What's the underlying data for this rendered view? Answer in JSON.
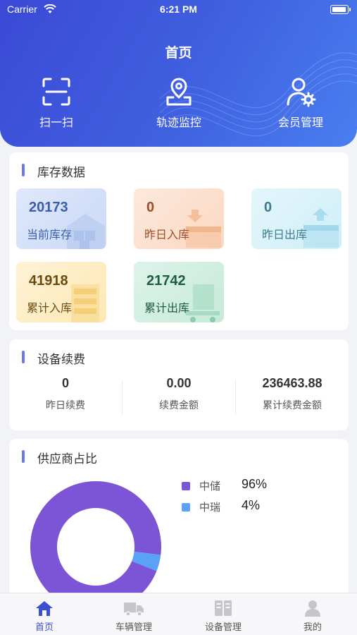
{
  "status_bar": {
    "carrier": "Carrier",
    "time": "6:21 PM"
  },
  "page_title": "首页",
  "quick_actions": [
    {
      "label": "扫一扫",
      "icon": "scan-icon"
    },
    {
      "label": "轨迹监控",
      "icon": "location-pin-icon"
    },
    {
      "label": "会员管理",
      "icon": "user-settings-icon"
    }
  ],
  "inventory": {
    "title": "库存数据",
    "tiles": [
      {
        "value": "20173",
        "label": "当前库存",
        "icon": "warehouse-icon",
        "color": "#3a5fa8"
      },
      {
        "value": "0",
        "label": "昨日入库",
        "icon": "inbound-box-icon",
        "color": "#9a4f28"
      },
      {
        "value": "0",
        "label": "昨日出库",
        "icon": "outbound-box-icon",
        "color": "#3b7b90"
      },
      {
        "value": "41918",
        "label": "累计入库",
        "icon": "shelf-icon",
        "color": "#6b4b12"
      },
      {
        "value": "21742",
        "label": "累计出库",
        "icon": "cart-icon",
        "color": "#1e5d43"
      }
    ]
  },
  "renewal": {
    "title": "设备续费",
    "items": [
      {
        "value": "0",
        "label": "昨日续费"
      },
      {
        "value": "0.00",
        "label": "续费金额"
      },
      {
        "value": "236463.88",
        "label": "累计续费金额"
      }
    ]
  },
  "suppliers": {
    "title": "供应商占比",
    "legend": [
      {
        "name": "中储",
        "percent": "96%",
        "color": "#7b55d6"
      },
      {
        "name": "中瑞",
        "percent": "4%",
        "color": "#5aa2f5"
      }
    ]
  },
  "chart_data": {
    "type": "pie",
    "categories": [
      "中储",
      "中瑞"
    ],
    "values": [
      96,
      4
    ],
    "colors": [
      "#7b55d6",
      "#5aa2f5"
    ]
  },
  "tabbar": {
    "items": [
      {
        "label": "首页",
        "icon": "home-icon",
        "active": true
      },
      {
        "label": "车辆管理",
        "icon": "truck-icon",
        "active": false
      },
      {
        "label": "设备管理",
        "icon": "device-icon",
        "active": false
      },
      {
        "label": "我的",
        "icon": "person-icon",
        "active": false
      }
    ]
  },
  "colors": {
    "accent": "#3c49d6",
    "active_tab": "#3b4fd0"
  }
}
